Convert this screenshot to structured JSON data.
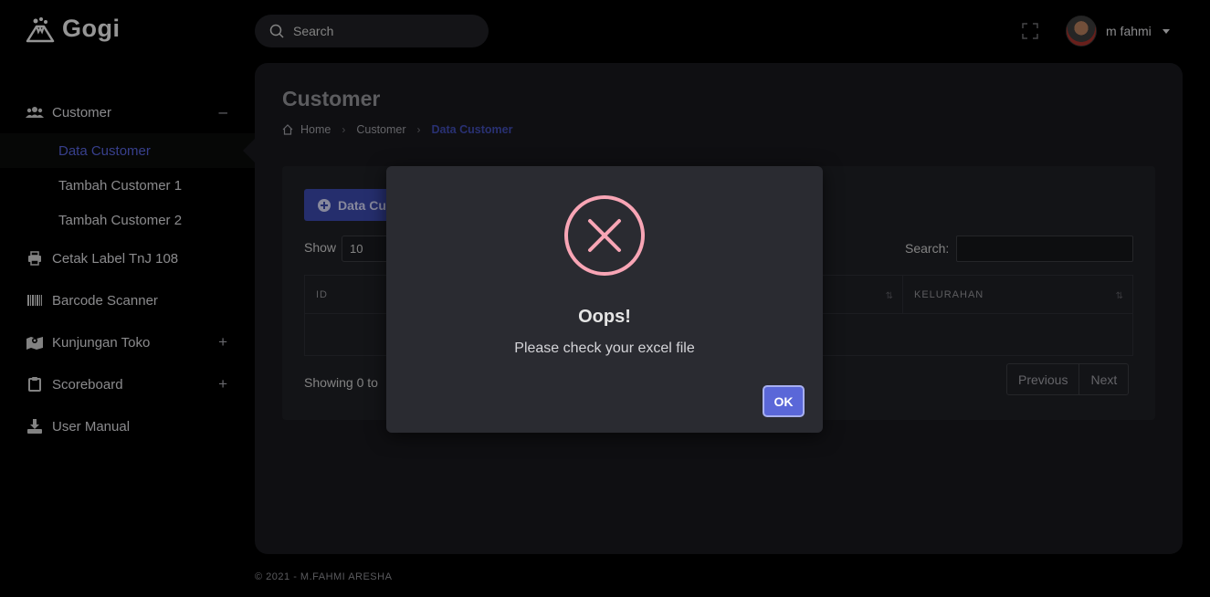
{
  "brand": {
    "name": "Gogi",
    "icon": "volcano-logo-icon"
  },
  "topbar": {
    "search_placeholder": "Search",
    "fullscreen_icon": "fullscreen-icon",
    "user_name": "m fahmi"
  },
  "sidebar": {
    "items": [
      {
        "label": "Customer",
        "icon": "users-icon",
        "toggle": "–"
      },
      {
        "label": "Cetak Label TnJ 108",
        "icon": "printer-icon"
      },
      {
        "label": "Barcode Scanner",
        "icon": "barcode-icon"
      },
      {
        "label": "Kunjungan Toko",
        "icon": "map-icon",
        "toggle": "+"
      },
      {
        "label": "Scoreboard",
        "icon": "clipboard-icon",
        "toggle": "+"
      },
      {
        "label": "User Manual",
        "icon": "download-icon"
      }
    ],
    "customer_sub": [
      {
        "label": "Data Customer",
        "active": true
      },
      {
        "label": "Tambah Customer 1"
      },
      {
        "label": "Tambah Customer 2"
      }
    ]
  },
  "page": {
    "title": "Customer",
    "breadcrumb": [
      "Home",
      "Customer",
      "Data Customer"
    ]
  },
  "card": {
    "add_button": "Data Customer",
    "show_label": "Show",
    "show_value": "10",
    "search_label": "Search:",
    "columns": [
      "ID",
      "KELURAHAN"
    ],
    "showing_text": "Showing 0 to",
    "pager": [
      "Previous",
      "Next"
    ]
  },
  "footer": {
    "text": "© 2021 - M.FAHMI ARESHA"
  },
  "modal": {
    "title": "Oops!",
    "message": "Please check your excel file",
    "ok_label": "OK",
    "icon": "error-x-icon",
    "icon_color": "#f8a5b5"
  },
  "colors": {
    "accent": "#5a67d8",
    "panel": "#17181d",
    "active_link": "#5561d6"
  }
}
